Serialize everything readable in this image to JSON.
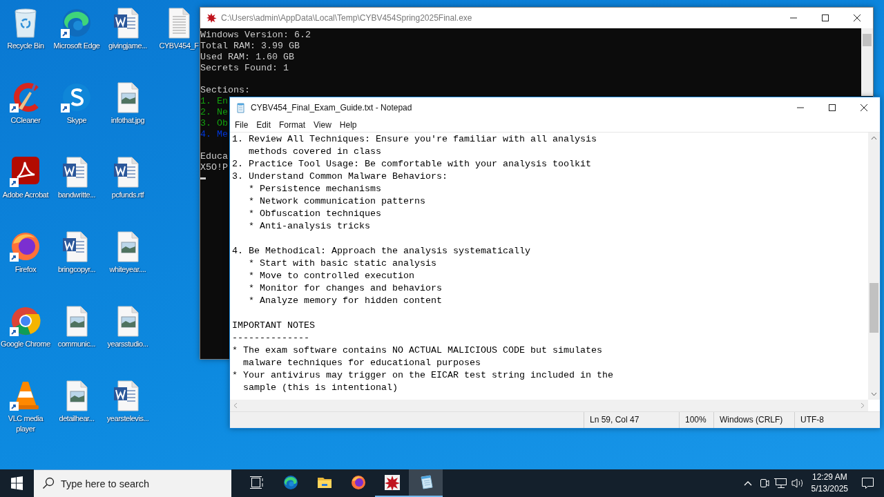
{
  "desktop": {
    "icons": [
      {
        "label": "Recycle Bin",
        "kind": "recycle",
        "shortcut": false
      },
      {
        "label": "CCleaner",
        "kind": "ccleaner",
        "shortcut": true
      },
      {
        "label": "Adobe Acrobat",
        "kind": "acrobat",
        "shortcut": true
      },
      {
        "label": "Firefox",
        "kind": "firefox",
        "shortcut": true
      },
      {
        "label": "Google Chrome",
        "kind": "chrome",
        "shortcut": true
      },
      {
        "label": "VLC media player",
        "kind": "vlc",
        "shortcut": true
      },
      {
        "label": "Microsoft Edge",
        "kind": "edge",
        "shortcut": true
      },
      {
        "label": "Skype",
        "kind": "skype",
        "shortcut": true
      },
      {
        "label": "bandwritte...",
        "kind": "word",
        "shortcut": false
      },
      {
        "label": "bringcopyr...",
        "kind": "word",
        "shortcut": false
      },
      {
        "label": "communic...",
        "kind": "image",
        "shortcut": false
      },
      {
        "label": "detailhear...",
        "kind": "image",
        "shortcut": false
      },
      {
        "label": "givingjame...",
        "kind": "word",
        "shortcut": false
      },
      {
        "label": "infothat.jpg",
        "kind": "image",
        "shortcut": false
      },
      {
        "label": "pcfunds.rtf",
        "kind": "word",
        "shortcut": false
      },
      {
        "label": "whiteyear....",
        "kind": "image",
        "shortcut": false
      },
      {
        "label": "yearsstudio...",
        "kind": "image",
        "shortcut": false
      },
      {
        "label": "yearstelevis...",
        "kind": "word",
        "shortcut": false
      },
      {
        "label": "CYBV454_F",
        "kind": "text",
        "shortcut": false
      }
    ]
  },
  "console_window": {
    "title": "C:\\Users\\admin\\AppData\\Local\\Temp\\CYBV454Spring2025Final.exe",
    "lines": [
      {
        "kind": "text",
        "text": "Windows Version: 6.2",
        "color": "#cccccc"
      },
      {
        "kind": "text",
        "text": "Total RAM: 3.99 GB",
        "color": "#cccccc"
      },
      {
        "kind": "text",
        "text": "Used RAM: 1.60 GB",
        "color": "#cccccc"
      },
      {
        "kind": "text",
        "text": "Secrets Found: 1",
        "color": "#cccccc"
      },
      {
        "kind": "blank"
      },
      {
        "kind": "text",
        "text": "Sections:",
        "color": "#cccccc"
      },
      {
        "kind": "text",
        "text": "1. En",
        "color": "#13a10e"
      },
      {
        "kind": "text",
        "text": "2. Ne",
        "color": "#13a10e"
      },
      {
        "kind": "text",
        "text": "3. Ob",
        "color": "#13a10e"
      },
      {
        "kind": "text",
        "text": "4. Me",
        "color": "#0037da"
      },
      {
        "kind": "blank"
      },
      {
        "kind": "text",
        "text": "Educa",
        "color": "#cccccc"
      },
      {
        "kind": "text",
        "text": "X5O!P",
        "color": "#cccccc"
      },
      {
        "kind": "cursor"
      }
    ]
  },
  "notepad_window": {
    "title": "CYBV454_Final_Exam_Guide.txt - Notepad",
    "menu": [
      "File",
      "Edit",
      "Format",
      "View",
      "Help"
    ],
    "lines": [
      {
        "kind": "text",
        "text": "1. Review All Techniques: Ensure you're familiar with all analysis"
      },
      {
        "kind": "text",
        "text": "   methods covered in class"
      },
      {
        "kind": "text",
        "text": "2. Practice Tool Usage: Be comfortable with your analysis toolkit"
      },
      {
        "kind": "text",
        "text": "3. Understand Common Malware Behaviors:"
      },
      {
        "kind": "text",
        "text": "   * Persistence mechanisms"
      },
      {
        "kind": "text",
        "text": "   * Network communication patterns"
      },
      {
        "kind": "text",
        "text": "   * Obfuscation techniques"
      },
      {
        "kind": "text",
        "text": "   * Anti-analysis tricks"
      },
      {
        "kind": "blank"
      },
      {
        "kind": "text",
        "text": "4. Be Methodical: Approach the analysis systematically"
      },
      {
        "kind": "text",
        "text": "   * Start with basic static analysis"
      },
      {
        "kind": "text",
        "text": "   * Move to controlled execution"
      },
      {
        "kind": "text",
        "text": "   * Monitor for changes and behaviors"
      },
      {
        "kind": "text",
        "text": "   * Analyze memory for hidden content"
      },
      {
        "kind": "blank"
      },
      {
        "kind": "text",
        "text": "IMPORTANT NOTES"
      },
      {
        "kind": "text",
        "text": "--------------"
      },
      {
        "kind": "text",
        "text": "* The exam software contains NO ACTUAL MALICIOUS CODE but simulates"
      },
      {
        "kind": "text",
        "text": "  malware techniques for educational purposes"
      },
      {
        "kind": "text",
        "text": "* Your antivirus may trigger on the EICAR test string included in the"
      },
      {
        "kind": "text",
        "text": "  sample (this is intentional)"
      }
    ],
    "status_bar": {
      "position": "Ln 59, Col 47",
      "zoom": "100%",
      "line_endings": "Windows (CRLF)",
      "encoding": "UTF-8"
    }
  },
  "taskbar": {
    "search": {
      "placeholder": "Type here to search"
    },
    "apps": [
      {
        "kind": "taskview",
        "running": false,
        "selected": false
      },
      {
        "kind": "edge",
        "running": false,
        "selected": false
      },
      {
        "kind": "explorer",
        "running": false,
        "selected": false
      },
      {
        "kind": "firefox",
        "running": false,
        "selected": false
      },
      {
        "kind": "exam",
        "running": true,
        "selected": false
      },
      {
        "kind": "notepad",
        "running": true,
        "selected": true
      }
    ],
    "tray": {
      "time": "12:29 AM",
      "date": "5/13/2025"
    }
  }
}
